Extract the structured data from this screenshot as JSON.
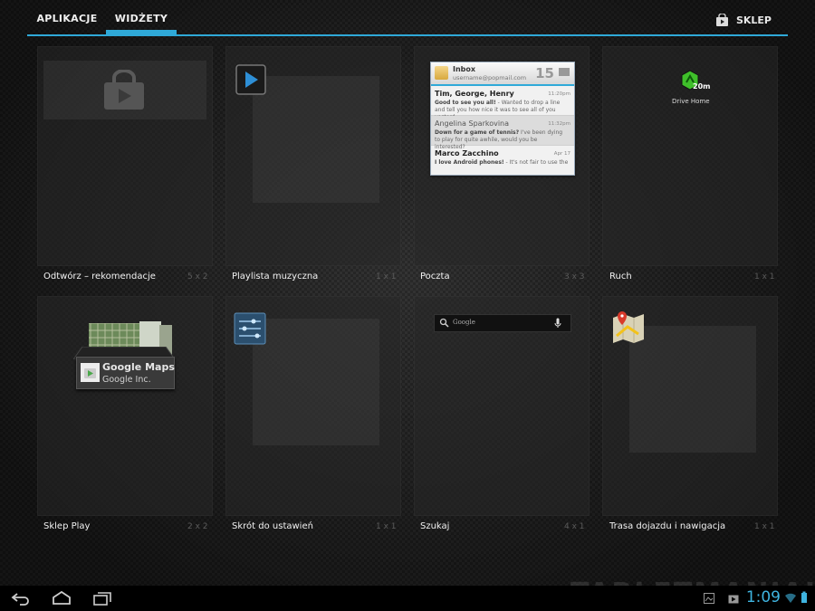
{
  "tabs": [
    {
      "label": "APLIKACJE",
      "active": false
    },
    {
      "label": "WIDŻETY",
      "active": true
    }
  ],
  "store": {
    "label": "SKLEP"
  },
  "widgets": [
    {
      "label": "Odtwórz – rekomendacje",
      "dims": "5 x 2"
    },
    {
      "label": "Playlista muzyczna",
      "dims": "1 x 1"
    },
    {
      "label": "Poczta",
      "dims": "3 x 3"
    },
    {
      "label": "Ruch",
      "dims": "1 x 1"
    },
    {
      "label": "Sklep Play",
      "dims": "2 x 2"
    },
    {
      "label": "Skrót do ustawień",
      "dims": "1 x 1"
    },
    {
      "label": "Szukaj",
      "dims": "4 x 1"
    },
    {
      "label": "Trasa dojazdu i nawigacja",
      "dims": "1 x 1"
    }
  ],
  "email_preview": {
    "title": "Inbox",
    "account": "username@popmail.com",
    "count": "15",
    "messages": [
      {
        "from": "Tim, George, Henry",
        "time": "11:20pm",
        "subject": "Good to see you all!",
        "snippet": " - Wanted to drop a line and tell you how nice it was to see all of you yesterd..."
      },
      {
        "from": "Angelina Sparkovina",
        "time": "11:32pm",
        "subject": "Down for a game of tennis?",
        "snippet": " I've been dying to play for quite awhile, would you be interested?"
      },
      {
        "from": "Marco Zacchino",
        "time": "Apr 17",
        "subject": "I love Android phones!",
        "snippet": " - It's not fair to use the"
      }
    ]
  },
  "traffic_preview": {
    "minutes": "20m",
    "label": "Drive Home"
  },
  "search_preview": {
    "placeholder": "Google"
  },
  "play_preview": {
    "app_title": "Google Maps",
    "developer": "Google Inc."
  },
  "status": {
    "time": "1:09"
  },
  "watermark": "TABLETMANIAK",
  "colors": {
    "accent": "#2fa9d8",
    "background": "#1b1b1b"
  }
}
